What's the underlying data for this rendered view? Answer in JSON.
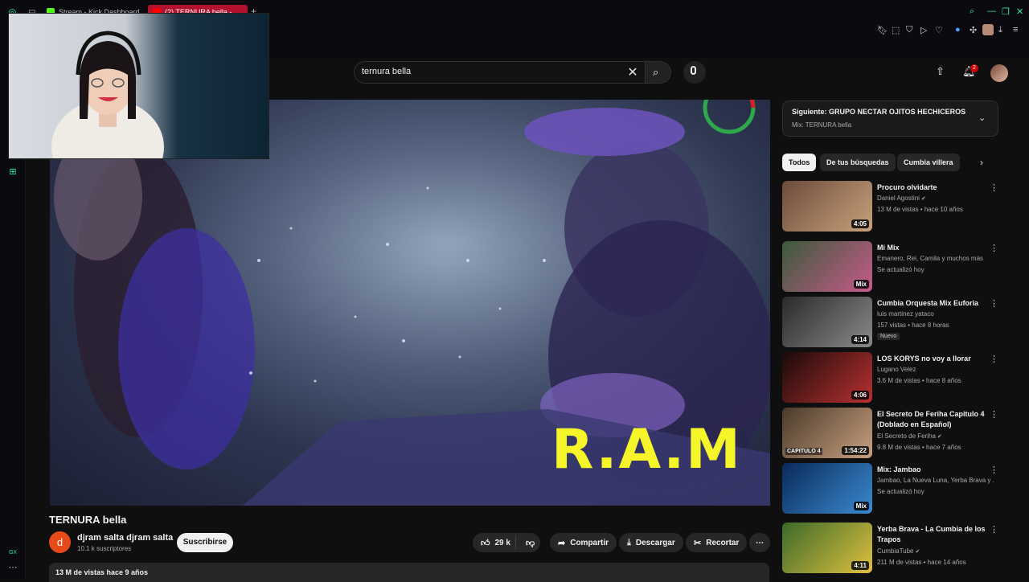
{
  "browser": {
    "tabs": [
      {
        "label": "Stream - Kick Dashboard",
        "favicon_color": "#53fc18"
      },
      {
        "label": "(2) TERNURA bella - ...",
        "favicon_color": "#ff0000"
      }
    ],
    "new_tab": "+",
    "accent": "#2ee6a8",
    "sidebar_footer": "GX"
  },
  "header": {
    "search_value": "ternura bella",
    "notification_count": "2"
  },
  "video": {
    "overlay_text": "R.A.M",
    "title": "TERNURA bella",
    "channel": {
      "avatar_letter": "d",
      "name": "djram salta djram salta",
      "subscribers": "10.1 k suscriptores"
    },
    "subscribe_label": "Suscribirse",
    "likes": "29 k",
    "share_label": "Compartir",
    "download_label": "Descargar",
    "clip_label": "Recortar",
    "description": "13 M de vistas  hace 9 años"
  },
  "up_next": {
    "title": "Siguiente: GRUPO NECTAR OJITOS HECHICEROS",
    "subtitle": "Mix: TERNURA bella"
  },
  "chips": [
    "Todos",
    "De tus búsquedas",
    "Cumbia villera"
  ],
  "recommendations": [
    {
      "title": "Procuro olvidarte",
      "channel": "Daniel Agostini",
      "verified": true,
      "meta": "13 M de vistas • hace 10 años",
      "duration": "4:05",
      "badge": "",
      "colors": [
        "#6b4a3a",
        "#c9a27c"
      ]
    },
    {
      "title": "Mi Mix",
      "channel": "Emanero, Rei, Camila y muchos más",
      "verified": false,
      "meta": "Se actualizó hoy",
      "duration": "Mix",
      "badge": "",
      "colors": [
        "#3a5a3a",
        "#c85a8a"
      ]
    },
    {
      "title": "Cumbia Orquesta Mix Euforia",
      "channel": "luis martinez yataco",
      "verified": false,
      "meta": "157 vistas • hace 8 horas",
      "duration": "4:14",
      "badge": "Nuevo",
      "colors": [
        "#2a2a2a",
        "#8a8a8a"
      ]
    },
    {
      "title": "LOS KORYS no voy a llorar",
      "channel": "Lugano Velez",
      "verified": false,
      "meta": "3.6 M de vistas • hace 8 años",
      "duration": "4:06",
      "badge": "",
      "colors": [
        "#1a0a0a",
        "#b83030"
      ]
    },
    {
      "title": "El Secreto De Feriha Capitulo 4 (Doblado en Español)",
      "channel": "El Secreto de Feriha",
      "verified": true,
      "meta": "9.8 M de vistas • hace 7 años",
      "duration": "1:54:22",
      "badge": "",
      "overlay": "CAPITULO 4",
      "colors": [
        "#4a3a2a",
        "#c8a080"
      ]
    },
    {
      "title": "Mix: Jambao",
      "channel": "Jambao, La Nueva Luna, Yerba Brava y ...",
      "verified": false,
      "meta": "Se actualizó hoy",
      "duration": "Mix",
      "badge": "",
      "colors": [
        "#0a2a5a",
        "#3a8ad0"
      ]
    },
    {
      "title": "Yerba Brava - La Cumbia de los Trapos",
      "channel": "CumbiaTube",
      "verified": true,
      "meta": "211 M de vistas • hace 14 años",
      "duration": "4:11",
      "badge": "",
      "colors": [
        "#3a6a2a",
        "#e0c040"
      ]
    }
  ]
}
